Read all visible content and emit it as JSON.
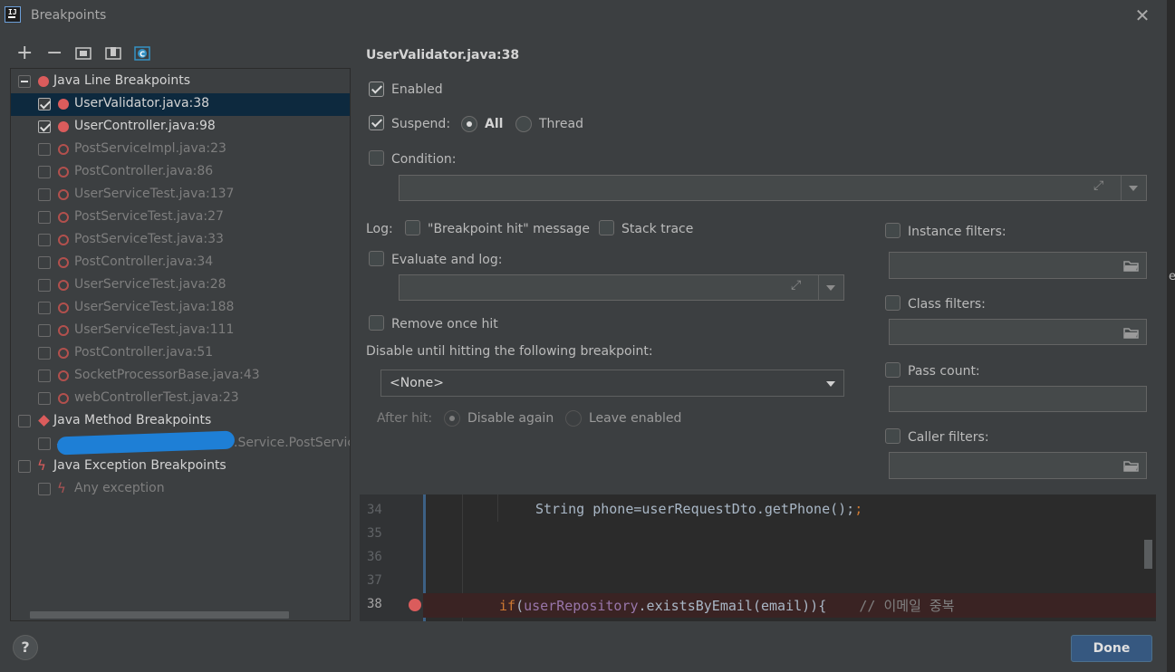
{
  "window": {
    "title": "Breakpoints",
    "close_glyph": "✕"
  },
  "toolbar": {
    "add_glyph": "+",
    "remove_glyph": "−"
  },
  "tree": {
    "groups": [
      {
        "label": "Java Line Breakpoints",
        "icon": "breakpoint-dot-icon"
      },
      {
        "label": "Java Method Breakpoints",
        "icon": "method-breakpoint-icon"
      },
      {
        "label": "Java Exception Breakpoints",
        "icon": "exception-breakpoint-icon"
      }
    ],
    "line_items": [
      {
        "label": "UserValidator.java:38",
        "enabled": true,
        "selected": true
      },
      {
        "label": "UserController.java:98",
        "enabled": true
      },
      {
        "label": "PostServiceImpl.java:23",
        "enabled": false
      },
      {
        "label": "PostController.java:86",
        "enabled": false
      },
      {
        "label": "UserServiceTest.java:137",
        "enabled": false
      },
      {
        "label": "PostServiceTest.java:27",
        "enabled": false
      },
      {
        "label": "PostServiceTest.java:33",
        "enabled": false
      },
      {
        "label": "PostController.java:34",
        "enabled": false
      },
      {
        "label": "UserServiceTest.java:28",
        "enabled": false
      },
      {
        "label": "UserServiceTest.java:188",
        "enabled": false
      },
      {
        "label": "UserServiceTest.java:111",
        "enabled": false
      },
      {
        "label": "PostController.java:51",
        "enabled": false
      },
      {
        "label": "SocketProcessorBase.java:43",
        "enabled": false
      },
      {
        "label": "webControllerTest.java:23",
        "enabled": false
      }
    ],
    "method_item": {
      "label": ".Service.PostService."
    },
    "exception_item": {
      "label": "Any exception"
    }
  },
  "details": {
    "heading": "UserValidator.java:38",
    "enabled_label": "Enabled",
    "suspend_label": "Suspend:",
    "suspend_all_label": "All",
    "suspend_thread_label": "Thread",
    "condition_label": "Condition:",
    "log_label": "Log:",
    "log_message_label": "\"Breakpoint hit\" message",
    "stack_trace_label": "Stack trace",
    "evaluate_label": "Evaluate and log:",
    "remove_once_hit_label": "Remove once hit",
    "disable_until_label": "Disable until hitting the following breakpoint:",
    "disable_until_value": "<None>",
    "after_hit_label": "After hit:",
    "disable_again_label": "Disable again",
    "leave_enabled_label": "Leave enabled",
    "instance_filters_label": "Instance filters:",
    "class_filters_label": "Class filters:",
    "pass_count_label": "Pass count:",
    "caller_filters_label": "Caller filters:"
  },
  "editor": {
    "lines": [
      {
        "number": "34",
        "code": "String phone=userRequestDto.getPhone();"
      },
      {
        "number": "35",
        "code": ""
      },
      {
        "number": "36",
        "code": ""
      },
      {
        "number": "37",
        "code": ""
      },
      {
        "number": "38",
        "code_kw": "if",
        "code_paren": "(",
        "code_field": "userRepository",
        "code_rest": ".existsByEmail(email)){",
        "comment": "// 이메일 중복"
      }
    ]
  },
  "footer": {
    "help_label": "?",
    "done_label": "Done"
  },
  "edge_text": "e",
  "colors": {
    "breakpoint": "#db5c5c",
    "selection": "#0d293e",
    "accent_button": "#365880"
  }
}
